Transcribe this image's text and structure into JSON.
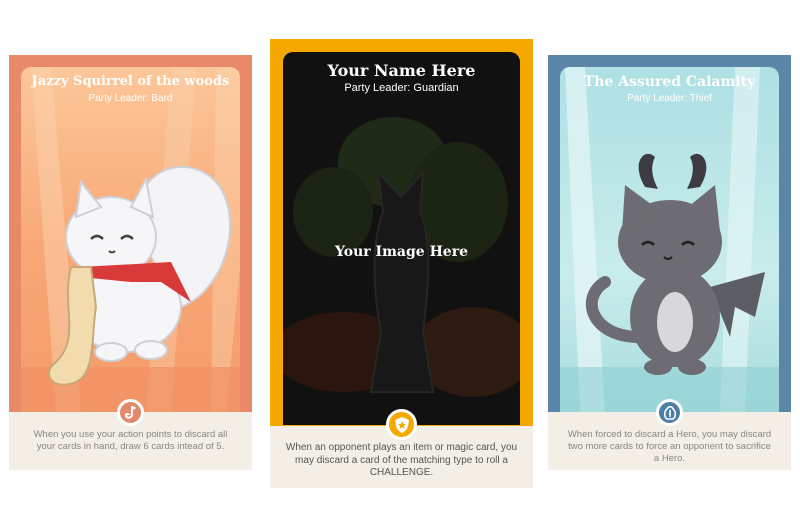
{
  "cards": [
    {
      "title": "Jazzy Squirrel of the woods",
      "subtitle": "Party Leader: Bard",
      "effect": "When you use your action points to discard all your cards in hand, draw 6 cards intead of 5.",
      "class_icon": "saxophone-icon",
      "frame_color": "#e88a6a",
      "badge_color": "#e2896c"
    },
    {
      "title": "Your Name Here",
      "subtitle": "Party Leader: Guardian",
      "image_placeholder": "Your Image Here",
      "effect": "When an opponent plays an item or magic card, you may discard a card of the matching type to roll a CHALLENGE.",
      "class_icon": "shield-icon",
      "frame_color": "#f5a800",
      "badge_color": "#f5a800"
    },
    {
      "title": "The Assured Calamity",
      "subtitle": "Party Leader: Thief",
      "effect": "When forced to discard a Hero, you may discard two more cards to force an opponent to sacrifice a Hero.",
      "class_icon": "money-bag-icon",
      "frame_color": "#5b86a8",
      "badge_color": "#4e7ea3"
    }
  ]
}
